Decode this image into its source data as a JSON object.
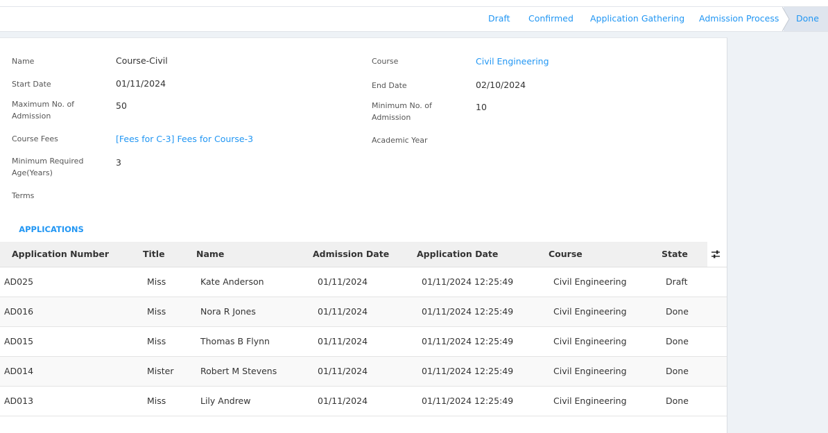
{
  "statusbar": {
    "stages": [
      "Draft",
      "Confirmed",
      "Application Gathering",
      "Admission Process"
    ],
    "active_stage": "Done"
  },
  "form": {
    "name_label": "Name",
    "name_value": "Course-Civil",
    "start_date_label": "Start Date",
    "start_date_value": "01/11/2024",
    "max_admission_label": "Maximum No. of Admission",
    "max_admission_value": "50",
    "course_fees_label": "Course Fees",
    "course_fees_value": "[Fees for C-3] Fees for Course-3",
    "min_age_label": "Minimum Required Age(Years)",
    "min_age_value": "3",
    "terms_label": "Terms",
    "course_label": "Course",
    "course_value": "Civil Engineering",
    "end_date_label": "End Date",
    "end_date_value": "02/10/2024",
    "min_admission_label": "Minimum No. of Admission",
    "min_admission_value": "10",
    "academic_year_label": "Academic Year"
  },
  "tabs": {
    "applications": "APPLICATIONS"
  },
  "table": {
    "headers": [
      "Application Number",
      "Title",
      "Name",
      "Admission Date",
      "Application Date",
      "Course",
      "State"
    ],
    "rows": [
      [
        "AD025",
        "Miss",
        "Kate Anderson",
        "01/11/2024",
        "01/11/2024 12:25:49",
        "Civil Engineering",
        "Draft"
      ],
      [
        "AD016",
        "Miss",
        "Nora R Jones",
        "01/11/2024",
        "01/11/2024 12:25:49",
        "Civil Engineering",
        "Done"
      ],
      [
        "AD015",
        "Miss",
        "Thomas B Flynn",
        "01/11/2024",
        "01/11/2024 12:25:49",
        "Civil Engineering",
        "Done"
      ],
      [
        "AD014",
        "Mister",
        "Robert M Stevens",
        "01/11/2024",
        "01/11/2024 12:25:49",
        "Civil Engineering",
        "Done"
      ],
      [
        "AD013",
        "Miss",
        "Lily Andrew",
        "01/11/2024",
        "01/11/2024 12:25:49",
        "Civil Engineering",
        "Done"
      ]
    ]
  },
  "icons": {
    "column_settings": "sliders-icon"
  },
  "colors": {
    "link": "#2196f3",
    "active_stage_bg": "#dfe5ee",
    "table_header_bg": "#f0f0f0"
  }
}
